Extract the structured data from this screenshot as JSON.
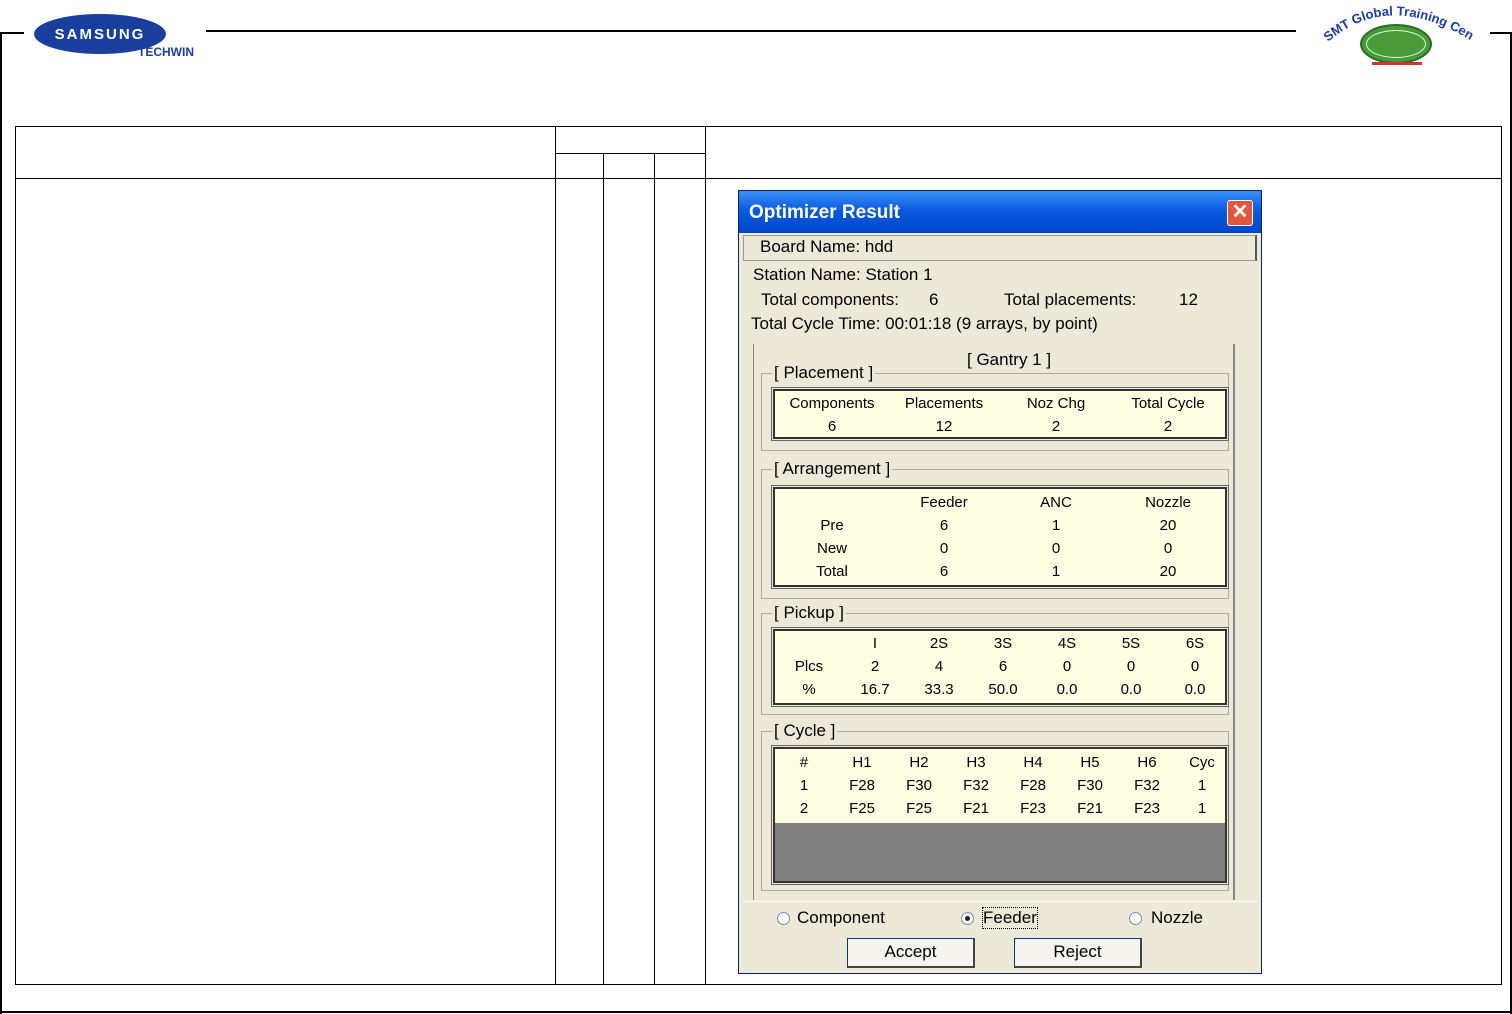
{
  "header": {
    "left_logo_brand": "SAMSUNG",
    "left_logo_sub": "TECHWIN",
    "right_logo_text": "SMT Global Training Center"
  },
  "dialog": {
    "title": "Optimizer Result",
    "board_name": "Board Name: hdd",
    "station_name": "Station Name: Station 1",
    "total_components_label": "Total components:",
    "total_components_value": "6",
    "total_placements_label": "Total placements:",
    "total_placements_value": "12",
    "total_cycle_time": "Total Cycle Time:  00:01:18 (9 arrays, by point)",
    "gantry_label": "[ Gantry  1 ]",
    "placement": {
      "legend": "[ Placement ]",
      "headers": [
        "Components",
        "Placements",
        "Noz Chg",
        "Total Cycle"
      ],
      "values": [
        "6",
        "12",
        "2",
        "2"
      ]
    },
    "arrangement": {
      "legend": "[ Arrangement ]",
      "headers": [
        "",
        "Feeder",
        "ANC",
        "Nozzle"
      ],
      "rows": [
        [
          "Pre",
          "6",
          "1",
          "20"
        ],
        [
          "New",
          "0",
          "0",
          "0"
        ],
        [
          "Total",
          "6",
          "1",
          "20"
        ]
      ]
    },
    "pickup": {
      "legend": "[ Pickup ]",
      "headers": [
        "",
        "I",
        "2S",
        "3S",
        "4S",
        "5S",
        "6S"
      ],
      "rows": [
        [
          "Plcs",
          "2",
          "4",
          "6",
          "0",
          "0",
          "0"
        ],
        [
          "%",
          "16.7",
          "33.3",
          "50.0",
          "0.0",
          "0.0",
          "0.0"
        ]
      ]
    },
    "cycle": {
      "legend": "[ Cycle ]",
      "headers": [
        "#",
        "H1",
        "H2",
        "H3",
        "H4",
        "H5",
        "H6",
        "Cyc"
      ],
      "rows": [
        [
          "1",
          "F28",
          "F30",
          "F32",
          "F28",
          "F30",
          "F32",
          "1"
        ],
        [
          "2",
          "F25",
          "F25",
          "F21",
          "F23",
          "F21",
          "F23",
          "1"
        ]
      ]
    },
    "view_options": [
      {
        "label": "Component",
        "selected": false
      },
      {
        "label": "Feeder",
        "selected": true
      },
      {
        "label": "Nozzle",
        "selected": false
      }
    ],
    "accept_label": "Accept",
    "reject_label": "Reject"
  }
}
